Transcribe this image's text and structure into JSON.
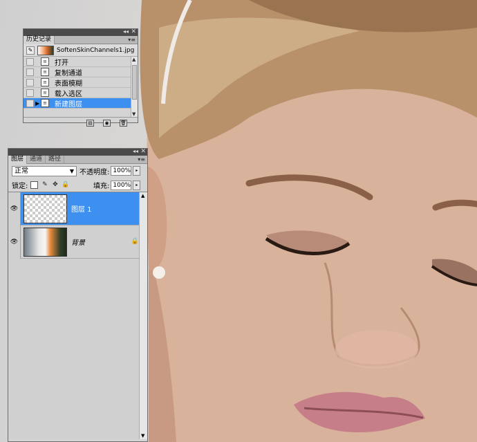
{
  "history_panel": {
    "tab": "历史记录",
    "snapshot_label": "SoftenSkinChannels1.jpg",
    "items": [
      {
        "label": "打开",
        "selected": false
      },
      {
        "label": "复制通道",
        "selected": false
      },
      {
        "label": "表面模糊",
        "selected": false
      },
      {
        "label": "载入选区",
        "selected": false
      },
      {
        "label": "新建图层",
        "selected": true
      }
    ]
  },
  "layers_panel": {
    "tabs": [
      "图层",
      "通道",
      "路径"
    ],
    "blend_mode": "正常",
    "opacity_label": "不透明度:",
    "opacity_value": "100%",
    "lock_label": "锁定:",
    "fill_label": "填充:",
    "fill_value": "100%",
    "layers": [
      {
        "name": "图层 1",
        "selected": true,
        "italic": false,
        "locked": false
      },
      {
        "name": "背景",
        "selected": false,
        "italic": true,
        "locked": true
      }
    ]
  },
  "colors": {
    "selection": "#3d8ff0",
    "panel_bg": "#d4d4d4",
    "titlebar": "#4a4a4a"
  },
  "icons": {
    "collapse": "double-chevron-icon",
    "close": "close-icon",
    "menu": "panel-menu-icon",
    "eye": "eye-icon",
    "lock": "lock-icon"
  }
}
